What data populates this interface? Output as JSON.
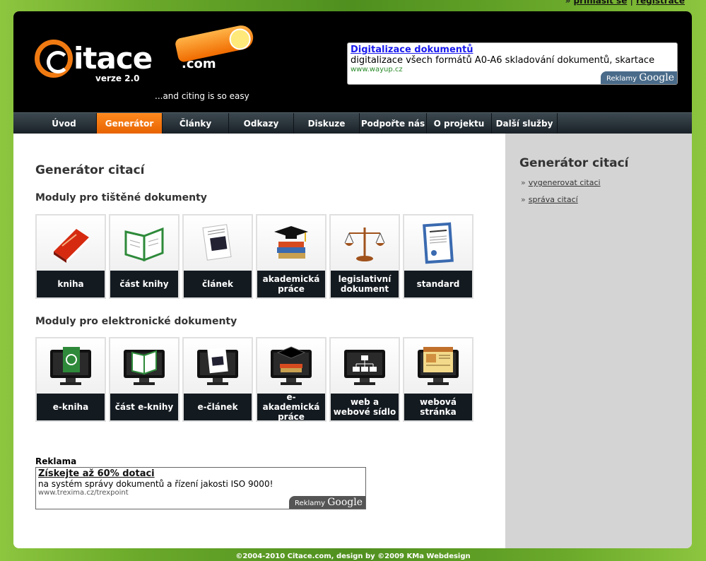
{
  "top_links": {
    "login": "přihlásit se",
    "separator": "|",
    "register": "registrace"
  },
  "logo": {
    "word": "itace",
    "dotcom": ".com",
    "version": "verze 2.0"
  },
  "tagline": "...and citing is so easy",
  "ad_top": {
    "title": "Digitalizace dokumentů",
    "text": "digitalizace všech formátů A0-A6 skladování dokumentů, skartace",
    "url": "www.wayup.cz",
    "badge_text": "Reklamy",
    "badge_brand": "Google"
  },
  "nav": [
    {
      "label": "Úvod"
    },
    {
      "label": "Generátor"
    },
    {
      "label": "Články"
    },
    {
      "label": "Odkazy"
    },
    {
      "label": "Diskuze"
    },
    {
      "label": "Podpořte nás"
    },
    {
      "label": "O projektu"
    },
    {
      "label": "Další služby"
    }
  ],
  "nav_active": "Generátor",
  "main": {
    "title": "Generátor citací",
    "printed_title": "Moduly pro tištěné dokumenty",
    "printed_modules": [
      {
        "label": "kniha",
        "icon": "book-icon"
      },
      {
        "label": "část knihy",
        "icon": "open-book-icon"
      },
      {
        "label": "článek",
        "icon": "newspaper-icon"
      },
      {
        "label": "akademická práce",
        "icon": "graduation-cap-icon"
      },
      {
        "label": "legislativní dokument",
        "icon": "scales-icon"
      },
      {
        "label": "standard",
        "icon": "standard-document-icon"
      }
    ],
    "electronic_title": "Moduly pro elektronické dokumenty",
    "electronic_modules": [
      {
        "label": "e-kniha",
        "icon": "monitor-ebook-icon"
      },
      {
        "label": "část e-knihy",
        "icon": "monitor-open-book-icon"
      },
      {
        "label": "e-článek",
        "icon": "monitor-article-icon"
      },
      {
        "label": "e-akademická práce",
        "icon": "monitor-graduation-icon"
      },
      {
        "label": "web a webové sídlo",
        "icon": "monitor-sitemap-icon"
      },
      {
        "label": "webová stránka",
        "icon": "monitor-webpage-icon"
      }
    ],
    "ad_label": "Reklama"
  },
  "ad_bottom": {
    "title": "Získejte až 60% dotaci",
    "text": "na systém správy dokumentů a řízení jakosti ISO 9000!",
    "url": "www.trexima.cz/trexpoint",
    "badge_text": "Reklamy",
    "badge_brand": "Google"
  },
  "sidebar": {
    "title": "Generátor citací",
    "links": [
      {
        "arrow": "»",
        "label": "vygenerovat citaci"
      },
      {
        "arrow": "»",
        "label": "správa citací"
      }
    ]
  },
  "footer": "©2004-2010 Citace.com, design by ©2009 KMa Webdesign",
  "colors": {
    "accent": "#f07a12",
    "header_bg": "#000000",
    "nav_bg": "#1a2228",
    "sidebar_bg": "#d4d4d4",
    "tile_label_bg": "#131a20"
  }
}
